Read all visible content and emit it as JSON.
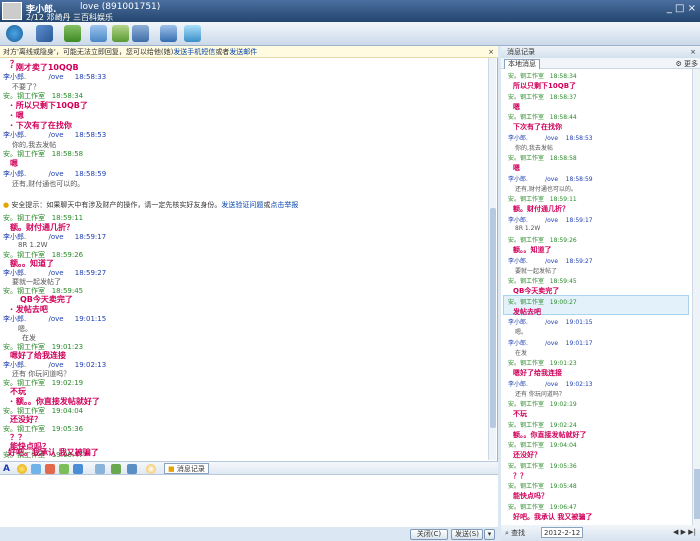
{
  "titlebar": {
    "name": "李小郎.",
    "id": "love (891001751)",
    "signature": "2/12 邓崎丹 三百科娱乐",
    "controls": "_ □ ×"
  },
  "toolbar": {
    "buttons": [
      "qq-icon",
      "pen-icon",
      "plus-icon",
      "mail-icon",
      "edit-icon",
      "list-icon",
      "arrows-icon",
      "share-icon"
    ]
  },
  "notice": {
    "text": "对方'离线或隐身'，可能无法立即回复，您可以给他(她)",
    "link1": "发送手机短信",
    "mid": "或者",
    "link2": "发送邮件",
    "close": "×"
  },
  "chat": [
    {
      "type": "red",
      "text": "？"
    },
    {
      "type": "red",
      "text": "刚才卖了10QQB"
    },
    {
      "type": "me",
      "sender": "李小郎.",
      "alias": "/ove",
      "time": "18:58:33"
    },
    {
      "type": "msg",
      "text": "不要了？"
    },
    {
      "type": "other",
      "sender": "安。钢工作室",
      "time": "18:58:34"
    },
    {
      "type": "red",
      "text": "所以只剩下10QB了"
    },
    {
      "type": "red",
      "text": "嗯"
    },
    {
      "type": "red",
      "text": "下次有了在找你"
    },
    {
      "type": "me",
      "sender": "李小郎.",
      "alias": "/ove",
      "time": "18:58:53"
    },
    {
      "type": "msg",
      "text": "你的,我去发帖"
    },
    {
      "type": "other",
      "sender": "安。钢工作室",
      "time": "18:58:58"
    },
    {
      "type": "red",
      "text": "嗯"
    },
    {
      "type": "me",
      "sender": "李小郎.",
      "alias": "/ove",
      "time": "18:58:59"
    },
    {
      "type": "msg",
      "text": "还有,财付通也可以的。"
    }
  ],
  "warning": {
    "text": "安全提示：如果聊天中有涉及财产的操作，请一定先核实好友身份。",
    "link1": "发送验证问题",
    "mid": "或",
    "link2": "点击举报"
  },
  "chat2": [
    {
      "type": "other",
      "sender": "安。钢工作室",
      "time": "18:59:11"
    },
    {
      "type": "red",
      "text": "额。财付通几折？"
    },
    {
      "type": "me",
      "sender": "李小郎.",
      "alias": "/ove",
      "time": "18:59:17"
    },
    {
      "type": "msg",
      "text": "8R 1.2W"
    },
    {
      "type": "other",
      "sender": "安。钢工作室",
      "time": "18:59:26"
    },
    {
      "type": "red",
      "text": "额。。知道了"
    },
    {
      "type": "me",
      "sender": "李小郎.",
      "alias": "/ove",
      "time": "18:59:27"
    },
    {
      "type": "msg",
      "text": "要就一起发帖了"
    },
    {
      "type": "other",
      "sender": "安。钢工作室",
      "time": "18:59:45"
    },
    {
      "type": "red",
      "text": "QB今天卖完了"
    },
    {
      "type": "red",
      "text": "发帖去吧"
    },
    {
      "type": "me",
      "sender": "李小郎.",
      "alias": "/ove",
      "time": "19:01:15"
    },
    {
      "type": "msg",
      "text": "嗯。"
    },
    {
      "type": "msg",
      "text": "在发"
    },
    {
      "type": "other",
      "sender": "安。钢工作室",
      "time": "19:01:23"
    },
    {
      "type": "red",
      "text": "嗯好了给我连接"
    },
    {
      "type": "me",
      "sender": "李小郎.",
      "alias": "/ove",
      "time": "19:02:13"
    },
    {
      "type": "msg",
      "text": "还有 你玩问道吗？"
    },
    {
      "type": "other",
      "sender": "安。钢工作室",
      "time": "19:02:19"
    },
    {
      "type": "red",
      "text": "不玩"
    },
    {
      "type": "red",
      "text": "额。。你直接发帖就好了"
    },
    {
      "type": "other",
      "sender": "安。钢工作室",
      "time": "19:04:04"
    },
    {
      "type": "red",
      "text": "还没好？"
    },
    {
      "type": "other",
      "sender": "安。钢工作室",
      "time": "19:05:36"
    },
    {
      "type": "red",
      "text": "？？"
    },
    {
      "type": "red",
      "text": "能快点吗？"
    },
    {
      "type": "other",
      "sender": "安。钢工作室",
      "time": "19:06:47"
    },
    {
      "type": "red",
      "text": "好吧。我承认  我又被骗了"
    }
  ],
  "input": {
    "msgrec_label": "消息记录",
    "close_label": "关闭(C)",
    "send_label": "发送(S)"
  },
  "history": {
    "title": "消息记录",
    "close": "×",
    "tab": "本地消息",
    "more": "更多",
    "find": "查找",
    "date": "2012-2-12",
    "items": [
      {
        "type": "other",
        "sender": "安。钢工作室",
        "time": "18:58:34"
      },
      {
        "type": "red",
        "text": "所以只剩下10QB了"
      },
      {
        "type": "other",
        "sender": "安。钢工作室",
        "time": "18:58:37"
      },
      {
        "type": "red",
        "text": "嗯"
      },
      {
        "type": "other",
        "sender": "安。钢工作室",
        "time": "18:58:44"
      },
      {
        "type": "red",
        "text": "下次有了在找你"
      },
      {
        "type": "me",
        "sender": "李小郎.",
        "alias": "/ove",
        "time": "18:58:53"
      },
      {
        "type": "msg",
        "text": "你的,我去发帖"
      },
      {
        "type": "other",
        "sender": "安。钢工作室",
        "time": "18:58:58"
      },
      {
        "type": "red",
        "text": "嗯"
      },
      {
        "type": "me",
        "sender": "李小郎.",
        "alias": "/ove",
        "time": "18:58:59"
      },
      {
        "type": "msg",
        "text": "还有,财付通也可以的。"
      },
      {
        "type": "other",
        "sender": "安。钢工作室",
        "time": "18:59:11"
      },
      {
        "type": "red",
        "text": "额。财付通几折？"
      },
      {
        "type": "me",
        "sender": "李小郎.",
        "alias": "/ove",
        "time": "18:59:17"
      },
      {
        "type": "msg",
        "text": "8R 1.2W"
      },
      {
        "type": "other",
        "sender": "安。钢工作室",
        "time": "18:59:26"
      },
      {
        "type": "red",
        "text": "额。。知道了"
      },
      {
        "type": "me",
        "sender": "李小郎.",
        "alias": "/ove",
        "time": "18:59:27"
      },
      {
        "type": "msg",
        "text": "要就一起发帖了"
      },
      {
        "type": "other",
        "sender": "安。钢工作室",
        "time": "18:59:45"
      },
      {
        "type": "red",
        "text": "QB今天卖完了"
      },
      {
        "type": "other",
        "sender": "安。钢工作室",
        "time": "19:00:27",
        "highlight": true
      },
      {
        "type": "red",
        "text": "发帖去吧"
      },
      {
        "type": "me",
        "sender": "李小郎.",
        "alias": "/ove",
        "time": "19:01:15"
      },
      {
        "type": "msg",
        "text": "嗯。"
      },
      {
        "type": "me",
        "sender": "李小郎.",
        "alias": "/ove",
        "time": "19:01:17"
      },
      {
        "type": "msg",
        "text": "在发"
      },
      {
        "type": "other",
        "sender": "安。钢工作室",
        "time": "19:01:23"
      },
      {
        "type": "red",
        "text": "嗯好了给我连接"
      },
      {
        "type": "me",
        "sender": "李小郎.",
        "alias": "/ove",
        "time": "19:02:13"
      },
      {
        "type": "msg",
        "text": "还有 你玩问道吗？"
      },
      {
        "type": "other",
        "sender": "安。钢工作室",
        "time": "19:02:19"
      },
      {
        "type": "red",
        "text": "不玩"
      },
      {
        "type": "other",
        "sender": "安。钢工作室",
        "time": "19:02:24"
      },
      {
        "type": "red",
        "text": "额。。你直接发帖就好了"
      },
      {
        "type": "other",
        "sender": "安。钢工作室",
        "time": "19:04:04"
      },
      {
        "type": "red",
        "text": "还没好？"
      },
      {
        "type": "other",
        "sender": "安。钢工作室",
        "time": "19:05:36"
      },
      {
        "type": "red",
        "text": "？？"
      },
      {
        "type": "other",
        "sender": "安。钢工作室",
        "time": "19:05:48"
      },
      {
        "type": "red",
        "text": "能快点吗？"
      },
      {
        "type": "other",
        "sender": "安。钢工作室",
        "time": "19:06:47"
      },
      {
        "type": "red",
        "text": "好吧。我承认  我又被骗了"
      }
    ]
  }
}
